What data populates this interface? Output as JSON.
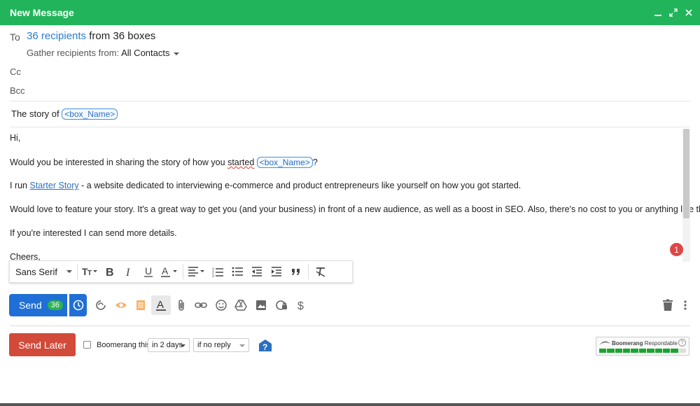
{
  "window": {
    "title": "New Message",
    "controls": [
      "minimize-icon",
      "expand-icon",
      "close-icon"
    ],
    "accent_color": "#22b45a"
  },
  "header": {
    "to_label": "To",
    "recipients_link": "36 recipients",
    "recipients_suffix": "from 36 boxes",
    "gather_label": "Gather recipients from:",
    "gather_value": "All Contacts",
    "cc_label": "Cc",
    "bcc_label": "Bcc"
  },
  "subject": {
    "text": "The story of",
    "merge_field": "<box_Name>"
  },
  "body": {
    "greeting": "Hi,",
    "line1_pre": "Would you be interested in sharing the story of how you",
    "line1_misspelled": "started",
    "line1_merge": "<box_Name>",
    "line1_post": "?",
    "line2_pre": "I run",
    "line2_link": "Starter Story",
    "line2_post": "- a website dedicated to interviewing e-commerce and product entrepreneurs like yourself on how you got started.",
    "line3": "Would love to feature your story. It's a great way to get you (and your business) in front of a new audience, as well as a boost in SEO. Also, there's no cost to you or anything like that.",
    "line4": "If you're interested I can send more details.",
    "closing": "Cheers,"
  },
  "notification_badge": "1",
  "format_bar": {
    "font": "Sans Serif",
    "buttons": [
      "text-size-icon",
      "bold-icon",
      "italic-icon",
      "underline-icon",
      "text-color-icon",
      "align-icon",
      "numbered-list-icon",
      "bulleted-list-icon",
      "indent-less-icon",
      "indent-more-icon",
      "quote-icon",
      "remove-formatting-icon"
    ]
  },
  "send": {
    "label": "Send",
    "count": "36",
    "color": "#1f6fd6"
  },
  "toolbar_icons": [
    "boomerang-icon",
    "read-receipt-icon",
    "notes-icon",
    "formatting-icon",
    "attach-icon",
    "link-icon",
    "emoji-icon",
    "drive-icon",
    "photo-icon",
    "confidential-icon",
    "money-icon"
  ],
  "boomerang": {
    "send_later_label": "Send Later",
    "send_later_color": "#d24a3a",
    "checkbox_label": "Boomerang this",
    "when": "in 2 days",
    "condition": "if no reply",
    "respondable_brand": "Boomerang",
    "respondable_label": "Respondable",
    "respondable_help": "?"
  }
}
